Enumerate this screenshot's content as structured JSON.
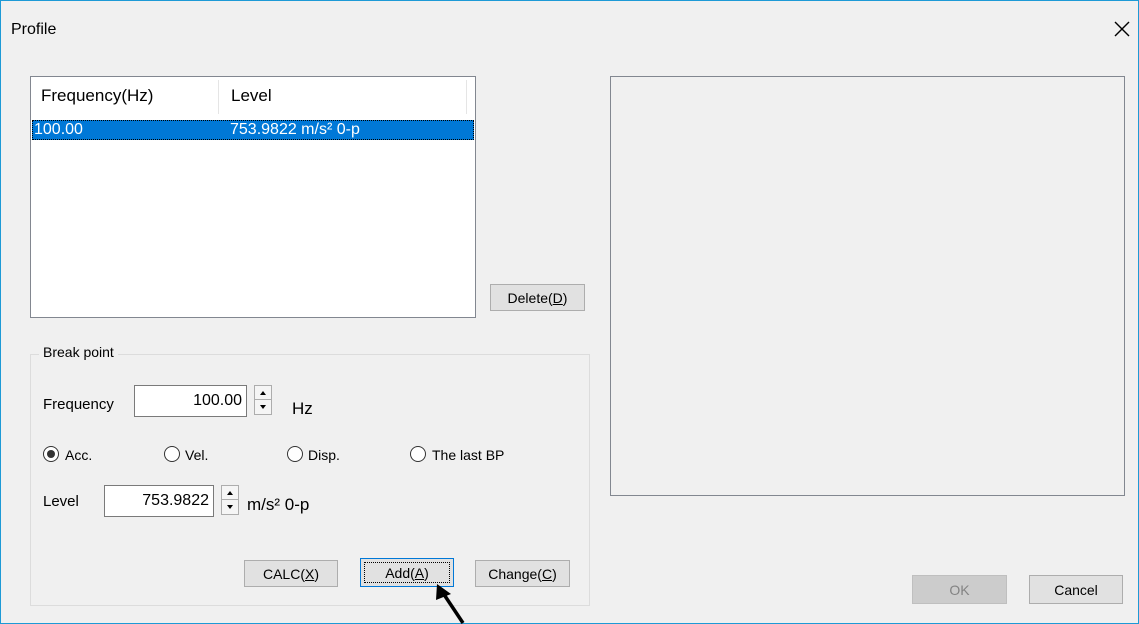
{
  "window": {
    "title": "Profile"
  },
  "list": {
    "columns": [
      "Frequency(Hz)",
      "Level"
    ],
    "rows": [
      {
        "frequency": "100.00",
        "level": "753.9822 m/s² 0-p"
      }
    ]
  },
  "delete_button": {
    "label": "Delete(",
    "accel": "D",
    "suffix": ")"
  },
  "breakpoint": {
    "group_label": "Break point",
    "frequency_label": "Frequency",
    "frequency_value": "100.00",
    "frequency_unit": "Hz",
    "radios": [
      {
        "label": "Acc.",
        "checked": true
      },
      {
        "label": "Vel.",
        "checked": false
      },
      {
        "label": "Disp.",
        "checked": false
      },
      {
        "label": "The last BP",
        "checked": false
      }
    ],
    "level_label": "Level",
    "level_value": "753.9822",
    "level_unit": "m/s² 0-p"
  },
  "buttons": {
    "calc": {
      "label": "CALC(",
      "accel": "X",
      "suffix": ")"
    },
    "add": {
      "label": "Add(",
      "accel": "A",
      "suffix": ")"
    },
    "change": {
      "label": "Change(",
      "accel": "C",
      "suffix": ")"
    },
    "ok": "OK",
    "cancel": "Cancel"
  },
  "icons": {
    "close": "close-icon",
    "spin_up": "spin-up-icon",
    "spin_down": "spin-down-icon",
    "pointer": "arrow-pointer-icon"
  }
}
